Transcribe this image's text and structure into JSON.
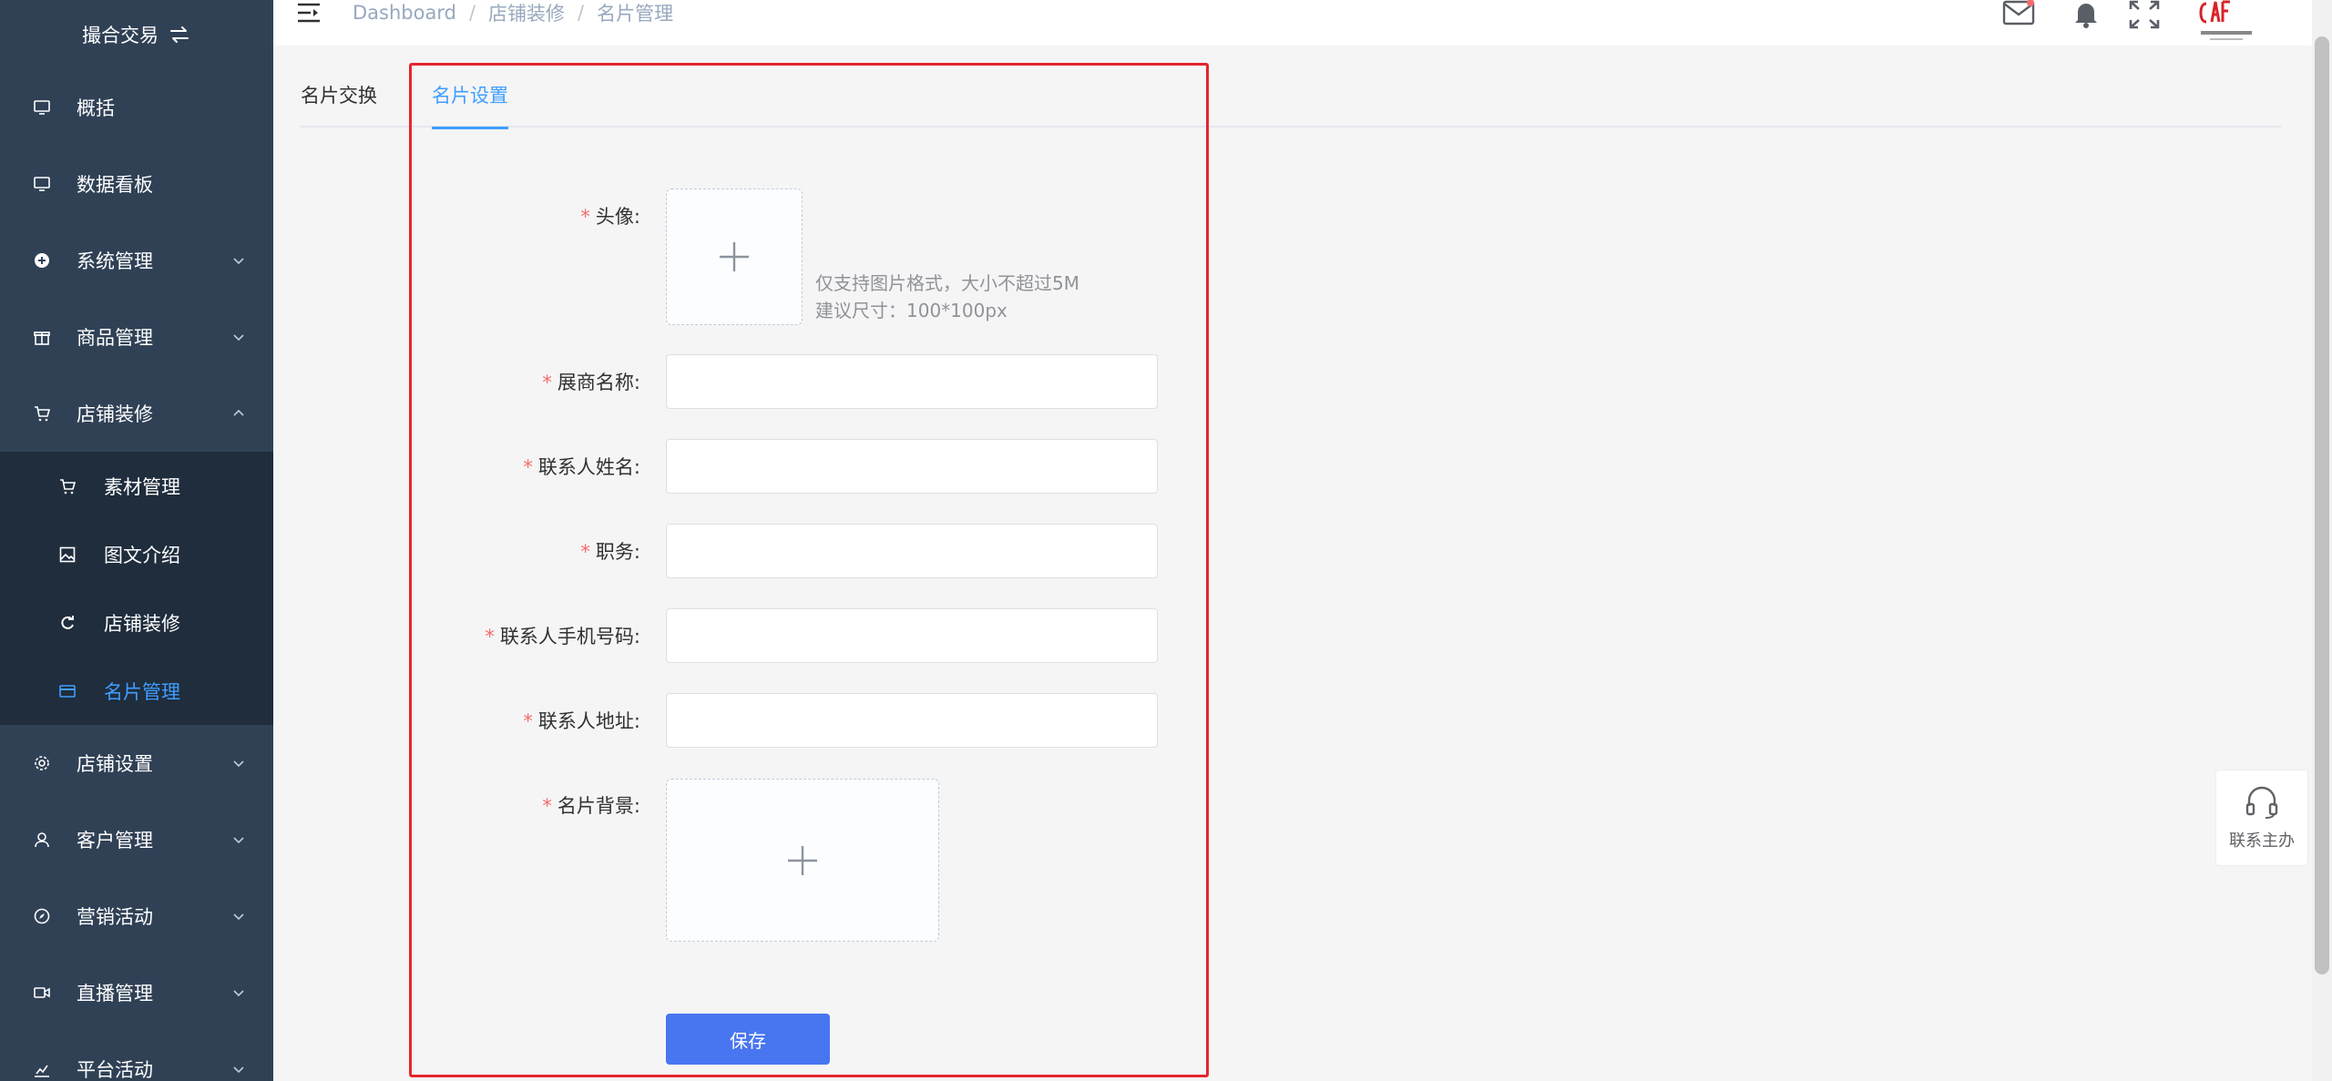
{
  "sidebar": {
    "brand": "撮合交易",
    "items": [
      {
        "label": "概括",
        "icon": "monitor-icon"
      },
      {
        "label": "数据看板",
        "icon": "monitor-icon"
      },
      {
        "label": "系统管理",
        "icon": "plus-circle-icon"
      },
      {
        "label": "商品管理",
        "icon": "gift-icon"
      },
      {
        "label": "店铺装修",
        "icon": "cart-icon"
      }
    ],
    "submenu": [
      {
        "label": "素材管理",
        "icon": "cart-icon"
      },
      {
        "label": "图文介绍",
        "icon": "picture-icon"
      },
      {
        "label": "店铺装修",
        "icon": "refresh-icon"
      },
      {
        "label": "名片管理",
        "icon": "card-icon"
      }
    ],
    "items_after": [
      {
        "label": "店铺设置",
        "icon": "gear-icon"
      },
      {
        "label": "客户管理",
        "icon": "user-icon"
      },
      {
        "label": "营销活动",
        "icon": "compass-icon"
      },
      {
        "label": "直播管理",
        "icon": "video-icon"
      },
      {
        "label": "平台活动",
        "icon": "chart-icon"
      }
    ]
  },
  "header": {
    "breadcrumb": [
      "Dashboard",
      "店铺装修",
      "名片管理"
    ],
    "sep": "/"
  },
  "tabs": [
    "名片交换",
    "名片设置"
  ],
  "form": {
    "avatar_label": "头像:",
    "avatar_tip_1": "仅支持图片格式，大小不超过5M",
    "avatar_tip_2": "建议尺寸：100*100px",
    "company_label": "展商名称:",
    "contact_name_label": "联系人姓名:",
    "position_label": "职务:",
    "phone_label": "联系人手机号码:",
    "address_label": "联系人地址:",
    "background_label": "名片背景:",
    "required_mark": "*",
    "save": "保存"
  },
  "contact_widget": {
    "label": "联系主办"
  },
  "colors": {
    "sidebar": "#304156",
    "submenu": "#1f2d3d",
    "accent": "#409eff",
    "button": "#4876f0",
    "highlight": "#e4262b"
  }
}
